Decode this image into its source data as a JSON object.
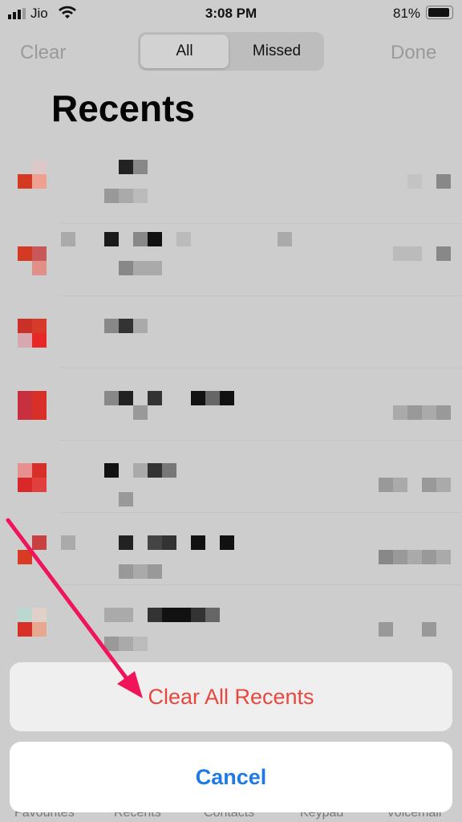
{
  "status": {
    "carrier": "Jio",
    "time": "3:08 PM",
    "battery": "81%",
    "battery_level": 0.81
  },
  "nav": {
    "clear": "Clear",
    "done": "Done",
    "segments": [
      {
        "label": "All",
        "selected": true
      },
      {
        "label": "Missed",
        "selected": false
      }
    ]
  },
  "title": "Recents",
  "action_sheet": {
    "clear_all": "Clear All Recents",
    "cancel": "Cancel"
  },
  "tabs": [
    "Favourites",
    "Recents",
    "Contacts",
    "Keypad",
    "Voicemail"
  ],
  "colors": {
    "destructive": "#e6483e",
    "accent": "#1f7ae8",
    "annotation_arrow": "#f0145a"
  }
}
